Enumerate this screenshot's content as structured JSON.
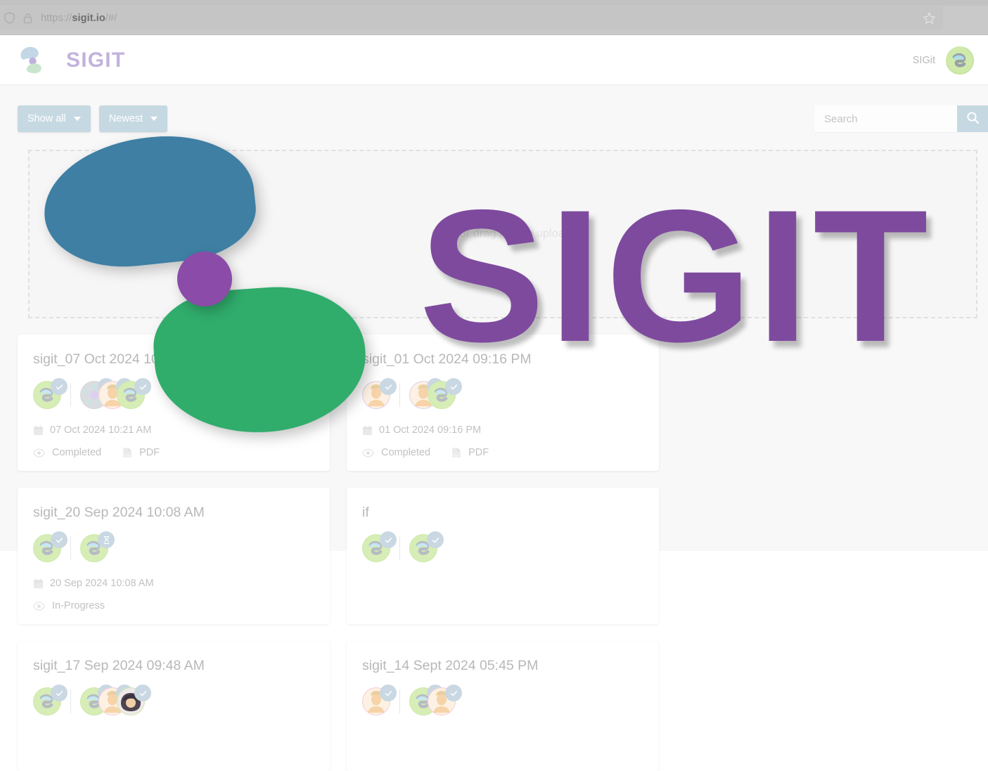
{
  "browser": {
    "url_scheme": "https://",
    "url_domain": "sigit.io",
    "url_path": "/#/",
    "shield_icon": "shield-icon",
    "lock_icon": "lock-icon",
    "star_icon": "star-icon"
  },
  "header": {
    "brand": "SIGIT",
    "user_name": "SIGit",
    "avatar_icon": "user-avatar"
  },
  "toolbar": {
    "filter_label": "Show all",
    "sort_label": "Newest",
    "search_placeholder": "Search",
    "search_value": "",
    "search_icon": "search-icon"
  },
  "dropzone": {
    "text": "Click or drag files to upload!"
  },
  "overlay": {
    "wordmark": "SIGIT",
    "color_blue": "#3e7fa3",
    "color_purple": "#8b4ba8",
    "color_green": "#30ac6b",
    "color_wordmark": "#7e4a9e"
  },
  "colors": {
    "accent": "#c6d9e2",
    "brand_word": "#c3b2dd",
    "page_bg": "#f8f8f8",
    "card_bg": "#ffffff",
    "text_muted": "#c2c2c2"
  },
  "cards": [
    {
      "title": "sigit_07 Oct 2024 10:21 AM",
      "date": "07 Oct 2024 10:21 AM",
      "status": "Completed",
      "file_type": "PDF",
      "owner": {
        "kind": "sig",
        "badge": "check"
      },
      "signers": [
        {
          "kind": "gray",
          "badge": "check"
        },
        {
          "kind": "person-pink",
          "badge": "check"
        },
        {
          "kind": "sig",
          "badge": "check"
        }
      ]
    },
    {
      "title": "sigit_01 Oct 2024 09:16 PM",
      "date": "01 Oct 2024 09:16 PM",
      "status": "Completed",
      "file_type": "PDF",
      "owner": {
        "kind": "person",
        "badge": "check"
      },
      "signers": [
        {
          "kind": "person",
          "badge": "check"
        },
        {
          "kind": "sig",
          "badge": "check"
        }
      ]
    },
    {
      "title": "sigit_20 Sep 2024 10:08 AM",
      "date": "20 Sep 2024 10:08 AM",
      "status": "In-Progress",
      "file_type": "",
      "owner": {
        "kind": "sig",
        "badge": "check"
      },
      "signers": [
        {
          "kind": "sig",
          "badge": "hourglass"
        }
      ]
    },
    {
      "title": "if",
      "date": "",
      "status": "",
      "file_type": "",
      "owner": {
        "kind": "sig",
        "badge": "check"
      },
      "signers": [
        {
          "kind": "sig",
          "badge": "check"
        }
      ]
    },
    {
      "title": "sigit_17 Sep 2024 09:48 AM",
      "date": "",
      "status": "",
      "file_type": "",
      "owner": {
        "kind": "sig",
        "badge": "check"
      },
      "signers": [
        {
          "kind": "sig",
          "badge": "check"
        },
        {
          "kind": "person-pink",
          "badge": "check"
        },
        {
          "kind": "dark",
          "badge": "check"
        }
      ]
    },
    {
      "title": "sigit_14 Sept 2024 05:45 PM",
      "date": "",
      "status": "",
      "file_type": "",
      "owner": {
        "kind": "person-pink",
        "badge": "check"
      },
      "signers": [
        {
          "kind": "sig",
          "badge": "check"
        },
        {
          "kind": "person-pink",
          "badge": "check"
        }
      ]
    }
  ]
}
